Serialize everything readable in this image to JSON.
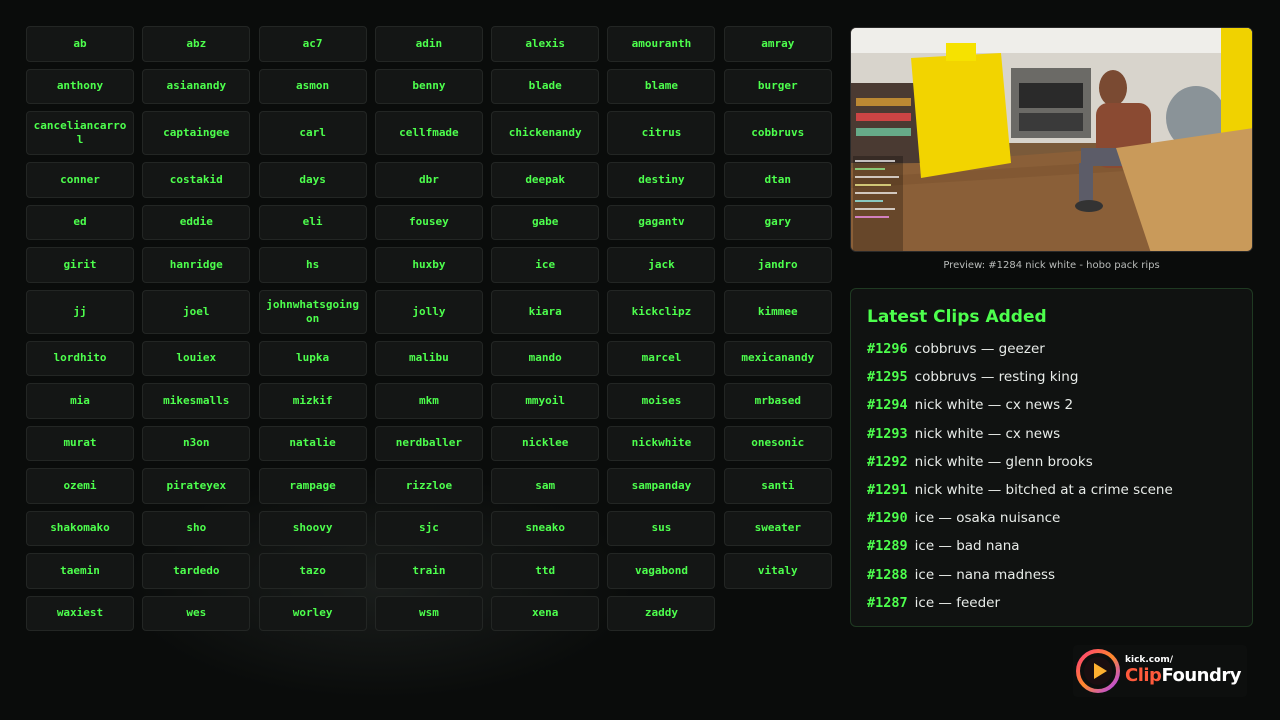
{
  "streamers": [
    "ab",
    "abz",
    "ac7",
    "adin",
    "alexis",
    "amouranth",
    "amray",
    "anthony",
    "asianandy",
    "asmon",
    "benny",
    "blade",
    "blame",
    "burger",
    "canceliancarrol",
    "captaingee",
    "carl",
    "cellfmade",
    "chickenandy",
    "citrus",
    "cobbruvs",
    "conner",
    "costakid",
    "days",
    "dbr",
    "deepak",
    "destiny",
    "dtan",
    "ed",
    "eddie",
    "eli",
    "fousey",
    "gabe",
    "gagantv",
    "gary",
    "girit",
    "hanridge",
    "hs",
    "huxby",
    "ice",
    "jack",
    "jandro",
    "jj",
    "joel",
    "johnwhatsgoingon",
    "jolly",
    "kiara",
    "kickclipz",
    "kimmee",
    "lordhito",
    "louiex",
    "lupka",
    "malibu",
    "mando",
    "marcel",
    "mexicanandy",
    "mia",
    "mikesmalls",
    "mizkif",
    "mkm",
    "mmyoil",
    "moises",
    "mrbased",
    "murat",
    "n3on",
    "natalie",
    "nerdballer",
    "nicklee",
    "nickwhite",
    "onesonic",
    "ozemi",
    "pirateyex",
    "rampage",
    "rizzloe",
    "sam",
    "sampanday",
    "santi",
    "shakomako",
    "sho",
    "shoovy",
    "sjc",
    "sneako",
    "sus",
    "sweater",
    "taemin",
    "tardedo",
    "tazo",
    "train",
    "ttd",
    "vagabond",
    "vitaly",
    "waxiest",
    "wes",
    "worley",
    "wsm",
    "xena",
    "zaddy"
  ],
  "tall_rows": [
    2,
    6
  ],
  "preview": {
    "caption": "Preview: #1284 nick white - hobo pack rips"
  },
  "clips": {
    "title": "Latest Clips Added",
    "items": [
      {
        "num": "#1296",
        "text": "cobbruvs — geezer"
      },
      {
        "num": "#1295",
        "text": "cobbruvs — resting king"
      },
      {
        "num": "#1294",
        "text": "nick white — cx news 2"
      },
      {
        "num": "#1293",
        "text": "nick white — cx news"
      },
      {
        "num": "#1292",
        "text": "nick white — glenn brooks"
      },
      {
        "num": "#1291",
        "text": "nick white — bitched at a crime scene"
      },
      {
        "num": "#1290",
        "text": "ice — osaka nuisance"
      },
      {
        "num": "#1289",
        "text": "ice — bad nana"
      },
      {
        "num": "#1288",
        "text": "ice — nana madness"
      },
      {
        "num": "#1287",
        "text": "ice — feeder"
      }
    ]
  },
  "logo": {
    "small": "kick.com/",
    "clip": "Clip",
    "foundry": "Foundry"
  },
  "colors": {
    "accent": "#4dff4d",
    "logo_orange": "#ff5a3c"
  }
}
